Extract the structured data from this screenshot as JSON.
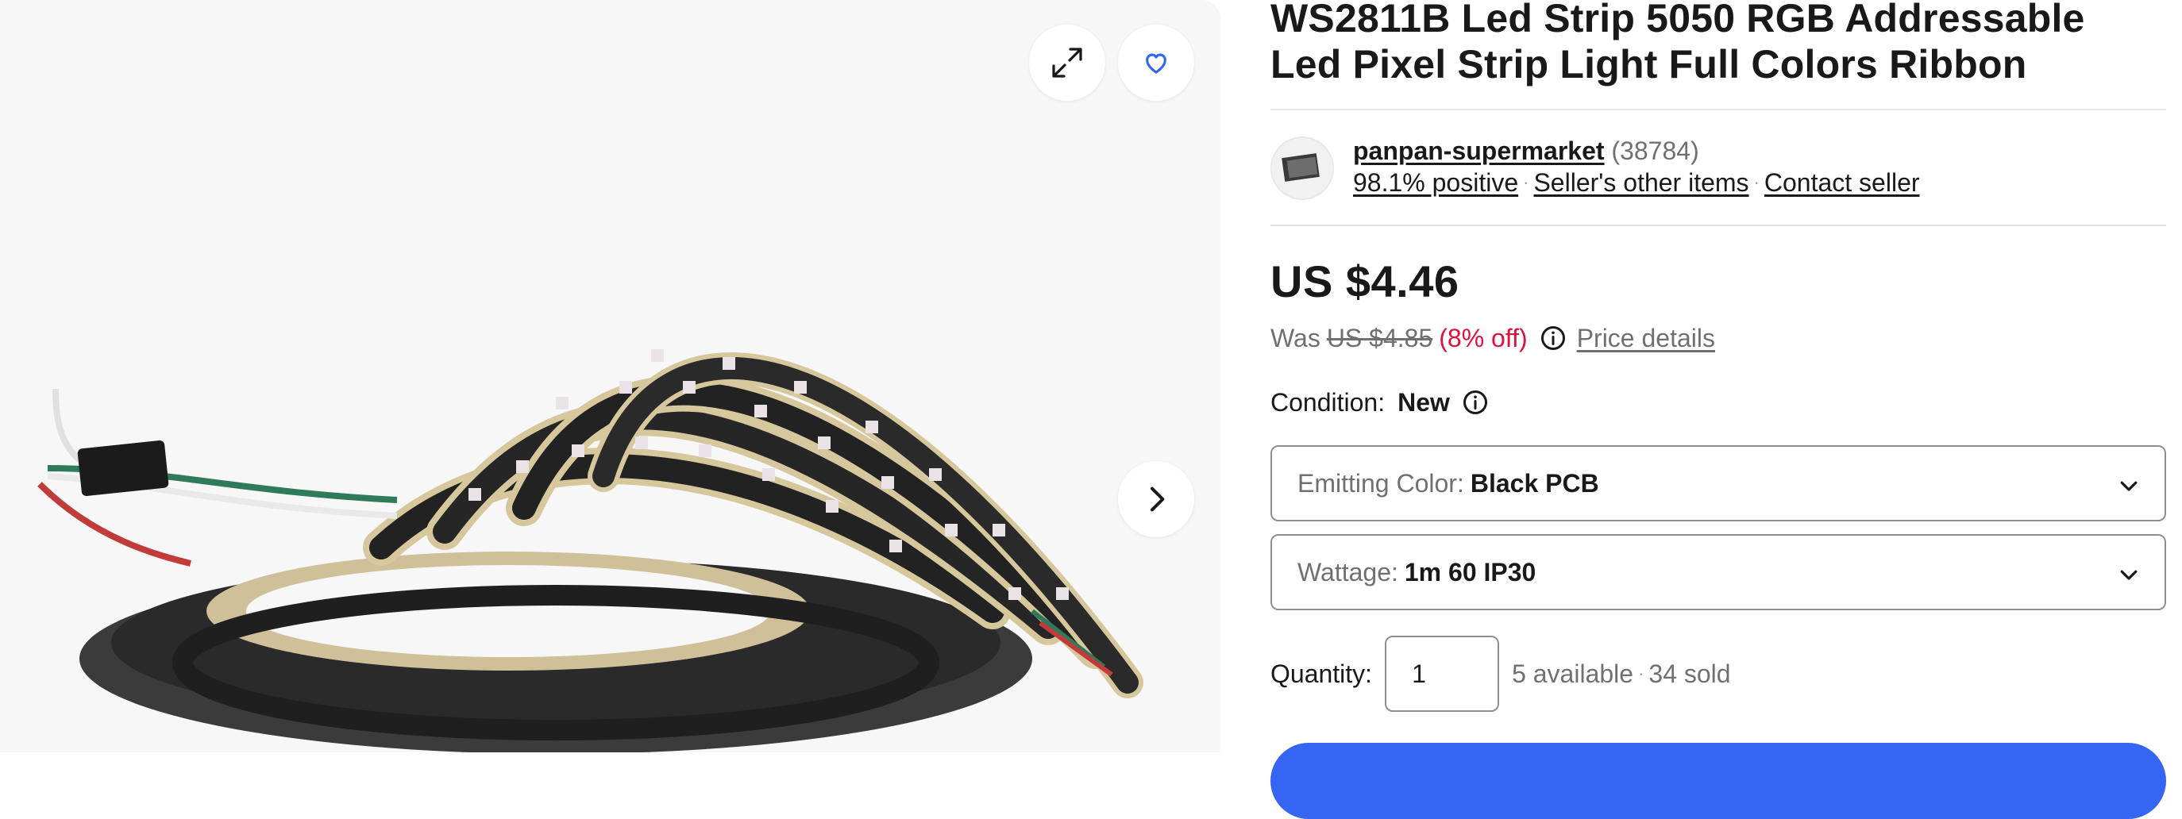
{
  "product": {
    "title": "WS2811B Led Strip 5050 RGB Addressable Led Pixel Strip Light Full Colors Ribbon"
  },
  "gallery": {
    "expand_icon": "expand-arrows-icon",
    "watch_icon": "heart-icon",
    "next_icon": "chevron-right-icon"
  },
  "seller": {
    "name": "panpan-supermarket",
    "feedback_count": "(38784)",
    "positive": "98.1% positive",
    "other_items": "Seller's other items",
    "contact": "Contact seller"
  },
  "pricing": {
    "price": "US $4.46",
    "was_label": "Was",
    "was_price": "US $4.85",
    "discount": "(8% off)",
    "details_link": "Price details"
  },
  "condition": {
    "label": "Condition:",
    "value": "New"
  },
  "options": [
    {
      "label": "Emitting Color:",
      "value": "Black PCB"
    },
    {
      "label": "Wattage:",
      "value": "1m 60 IP30"
    }
  ],
  "quantity": {
    "label": "Quantity:",
    "value": "1",
    "available": "5 available",
    "sold": "34 sold"
  },
  "colors": {
    "accent": "#3665f3",
    "discount": "#e0103a",
    "muted": "#707070"
  }
}
